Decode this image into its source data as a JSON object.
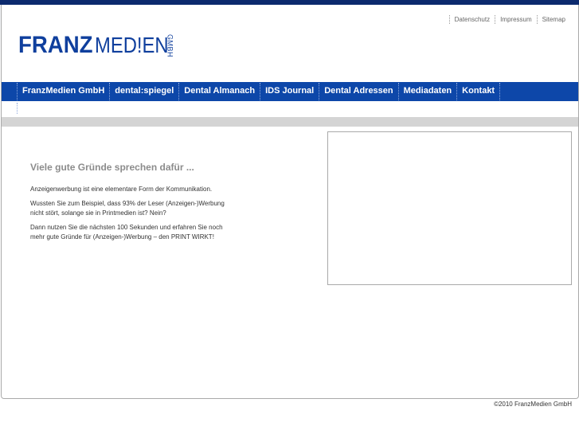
{
  "utility_nav": [
    "Datenschutz",
    "Impressum",
    "Sitemap"
  ],
  "logo": {
    "part1": "FRANZ",
    "part2": "MED!EN",
    "part3": "GMBH",
    "color": "#0f3f9d"
  },
  "main_nav": [
    "FranzMedien GmbH",
    "dental:spiegel",
    "Dental Almanach",
    "IDS Journal",
    "Dental Adressen",
    "Mediadaten",
    "Kontakt"
  ],
  "content": {
    "heading": "Viele gute Gründe sprechen dafür ...",
    "paragraphs": [
      "Anzeigenwerbung ist eine elementare Form der Kommunikation.",
      "Wussten Sie zum Beispiel, dass 93% der Leser (Anzeigen-)Werbung nicht stört, solange sie in Printmedien ist? Nein?",
      "Dann nutzen Sie die nächsten 100 Sekunden und erfahren Sie noch mehr gute Gründe für (Anzeigen-)Werbung – den PRINT WIRKT!"
    ]
  },
  "footer": "©2010 FranzMedien GmbH",
  "colors": {
    "nav_bg": "#0d47a9",
    "top_bar": "#0c2a6e",
    "grey_bar": "#d4d4d4"
  }
}
